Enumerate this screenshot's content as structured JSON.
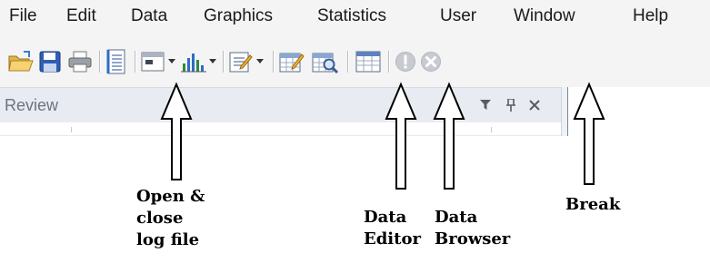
{
  "menubar": {
    "items": [
      {
        "id": "file",
        "label": "File"
      },
      {
        "id": "edit",
        "label": "Edit"
      },
      {
        "id": "data",
        "label": "Data"
      },
      {
        "id": "graphics",
        "label": "Graphics"
      },
      {
        "id": "statistics",
        "label": "Statistics"
      },
      {
        "id": "user",
        "label": "User"
      },
      {
        "id": "window",
        "label": "Window"
      },
      {
        "id": "help",
        "label": "Help"
      }
    ]
  },
  "toolbar": {
    "icons": [
      "open-folder-icon",
      "save-icon",
      "print-icon",
      "log-icon",
      "viewer-icon",
      "dropdown-arrow-icon",
      "graph-icon",
      "dropdown-arrow-icon",
      "do-file-editor-icon",
      "dropdown-arrow-icon",
      "data-editor-icon",
      "data-browser-icon",
      "variables-manager-icon",
      "more-icon",
      "break-icon"
    ]
  },
  "review_pane": {
    "title": "Review",
    "controls": [
      "filter-icon",
      "pin-icon",
      "close-icon"
    ]
  },
  "annotations": {
    "log_file": [
      "Open &",
      "close",
      "log file"
    ],
    "data_editor": [
      "Data",
      "Editor"
    ],
    "data_browser": [
      "Data",
      "Browser"
    ],
    "break": [
      "Break"
    ]
  },
  "colors": {
    "arrow_stroke": "#000000",
    "arrow_fill": "#ffffff",
    "toolbar_bg": "#f4f4f4",
    "pane_header_bg": "#e8ecf2",
    "break_icon": "#c8ccd2"
  }
}
